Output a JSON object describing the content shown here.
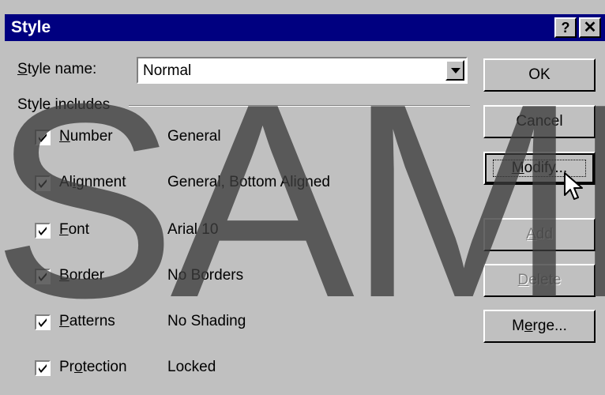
{
  "window": {
    "title": "Style"
  },
  "titlebar_buttons": {
    "help": "?",
    "close": "✕"
  },
  "style_name": {
    "label_pre": "",
    "label_u": "S",
    "label_post": "tyle name:",
    "value": "Normal"
  },
  "group": {
    "label": "Style includes"
  },
  "items": [
    {
      "pre": "",
      "u": "N",
      "post": "umber",
      "value": "General",
      "checked": true
    },
    {
      "pre": "Al",
      "u": "i",
      "post": "gnment",
      "value": "General, Bottom Aligned",
      "checked": true
    },
    {
      "pre": "",
      "u": "F",
      "post": "ont",
      "value": "Arial 10",
      "checked": true
    },
    {
      "pre": "",
      "u": "B",
      "post": "order",
      "value": "No Borders",
      "checked": true
    },
    {
      "pre": "",
      "u": "P",
      "post": "atterns",
      "value": "No Shading",
      "checked": true
    },
    {
      "pre": "Pr",
      "u": "o",
      "post": "tection",
      "value": "Locked",
      "checked": true
    }
  ],
  "buttons": {
    "ok": "OK",
    "cancel": "Cancel",
    "modify": {
      "pre": "",
      "u": "M",
      "post": "odify..."
    },
    "add": {
      "pre": "",
      "u": "A",
      "post": "dd"
    },
    "delete": {
      "pre": "",
      "u": "D",
      "post": "elete"
    },
    "merge": {
      "pre": "M",
      "u": "e",
      "post": "rge..."
    }
  },
  "watermark": "SAMP",
  "colors": {
    "titlebar": "#000080",
    "face": "#c0c0c0"
  }
}
